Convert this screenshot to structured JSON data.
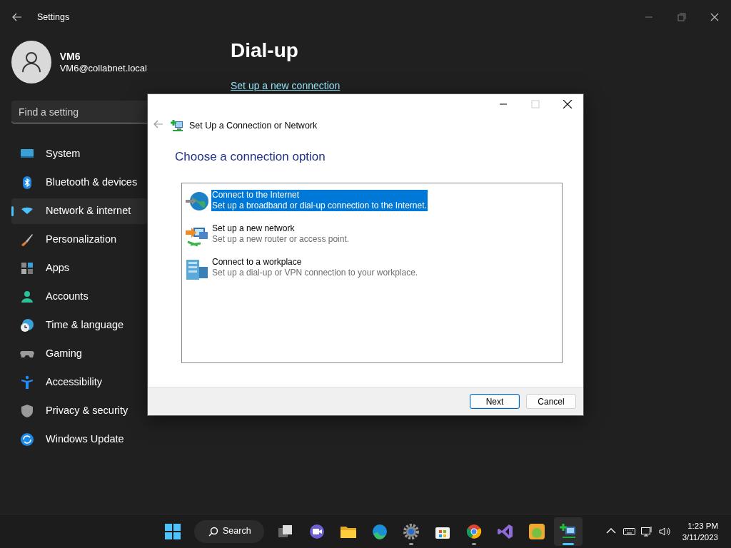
{
  "settings": {
    "title": "Settings",
    "user": {
      "name": "VM6",
      "email": "VM6@collabnet.local"
    },
    "search": {
      "placeholder": "Find a setting"
    },
    "nav": [
      {
        "label": "System",
        "kind": "system",
        "selected": false
      },
      {
        "label": "Bluetooth & devices",
        "kind": "bluetooth",
        "selected": false
      },
      {
        "label": "Network & internet",
        "kind": "network",
        "selected": true
      },
      {
        "label": "Personalization",
        "kind": "brush",
        "selected": false
      },
      {
        "label": "Apps",
        "kind": "apps",
        "selected": false
      },
      {
        "label": "Accounts",
        "kind": "accounts",
        "selected": false
      },
      {
        "label": "Time & language",
        "kind": "time",
        "selected": false
      },
      {
        "label": "Gaming",
        "kind": "gaming",
        "selected": false
      },
      {
        "label": "Accessibility",
        "kind": "accessibility",
        "selected": false
      },
      {
        "label": "Privacy & security",
        "kind": "privacy",
        "selected": false
      },
      {
        "label": "Windows Update",
        "kind": "update",
        "selected": false
      }
    ],
    "page": {
      "title": "Dial-up",
      "link": "Set up a new connection"
    }
  },
  "dialog": {
    "title": "Set Up a Connection or Network",
    "heading": "Choose a connection option",
    "options": [
      {
        "kind": "internet",
        "title": "Connect to the Internet",
        "description": "Set up a broadband or dial-up connection to the Internet.",
        "selected": true
      },
      {
        "kind": "network",
        "title": "Set up a new network",
        "description": "Set up a new router or access point.",
        "selected": false
      },
      {
        "kind": "workplace",
        "title": "Connect to a workplace",
        "description": "Set up a dial-up or VPN connection to your workplace.",
        "selected": false
      }
    ],
    "buttons": [
      {
        "label": "Next",
        "default": true
      },
      {
        "label": "Cancel",
        "default": false
      }
    ]
  },
  "taskbar": {
    "search_label": "Search",
    "apps": [
      {
        "kind": "taskview",
        "running": false,
        "active": false
      },
      {
        "kind": "chat",
        "running": false,
        "active": false
      },
      {
        "kind": "explorer",
        "running": false,
        "active": false
      },
      {
        "kind": "edge",
        "running": false,
        "active": false
      },
      {
        "kind": "settings",
        "running": true,
        "active": false
      },
      {
        "kind": "store",
        "running": false,
        "active": false
      },
      {
        "kind": "chrome",
        "running": true,
        "active": false
      },
      {
        "kind": "studio",
        "running": false,
        "active": false
      },
      {
        "kind": "game",
        "running": false,
        "active": false
      },
      {
        "kind": "netsetup",
        "running": true,
        "active": true
      }
    ],
    "time": "1:23 PM",
    "date": "3/11/2023"
  }
}
